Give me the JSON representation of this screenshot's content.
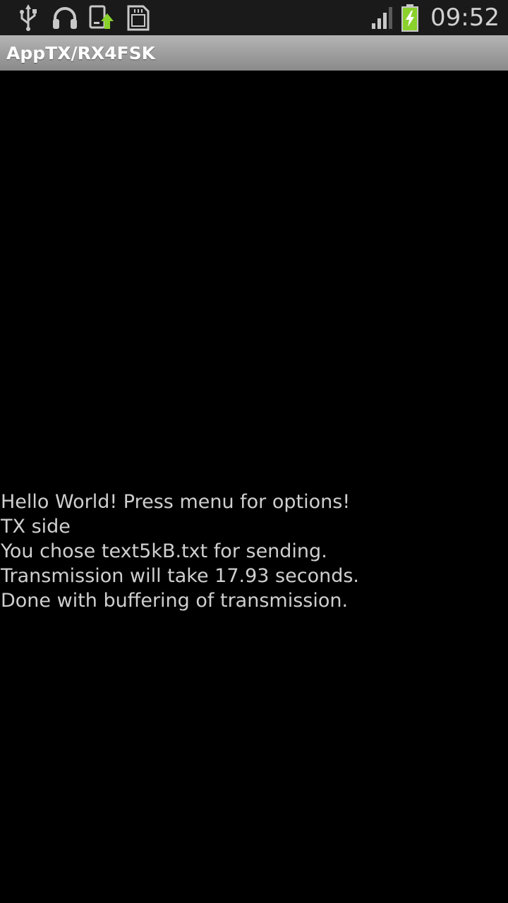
{
  "status_bar": {
    "notification_icons": [
      "usb-icon",
      "headphones-icon",
      "sync-upload-icon",
      "sd-card-icon"
    ],
    "system_icons": [
      "signal-icon",
      "battery-charging-icon"
    ],
    "time": "09:52"
  },
  "app": {
    "title": "AppTX/RX4FSK"
  },
  "log": {
    "lines": [
      "Hello World! Press menu for options!",
      "TX side",
      "You chose text5kB.txt for sending.",
      "Transmission will take 17.93 seconds.",
      "Done with buffering of transmission."
    ]
  },
  "colors": {
    "background": "#000000",
    "status_bar": "#1a1a1a",
    "title_bar_top": "#b4b4b4",
    "title_bar_bottom": "#8a8a8a",
    "text": "#cfcfcf",
    "accent_green": "#8bd12c"
  }
}
